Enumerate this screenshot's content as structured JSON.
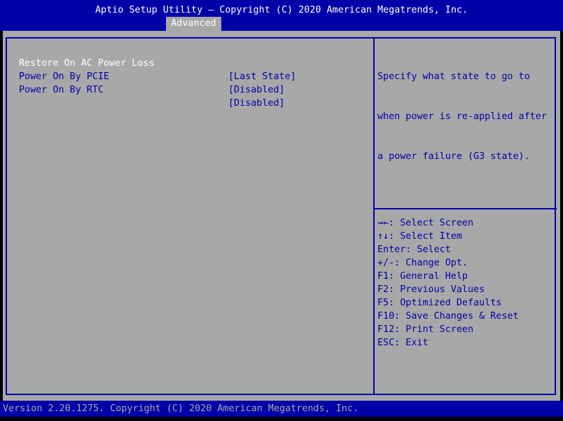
{
  "header": {
    "title": "Aptio Setup Utility – Copyright (C) 2020 American Megatrends, Inc.",
    "tab": "Advanced"
  },
  "settings": [
    {
      "label": "Restore On AC Power Loss",
      "value": "[Last State]"
    },
    {
      "label": "Power On By PCIE",
      "value": "[Disabled]"
    },
    {
      "label": "Power On By RTC",
      "value": "[Disabled]"
    }
  ],
  "help": {
    "lines": [
      "Specify what state to go to",
      "when power is re-applied after",
      "a power failure (G3 state)."
    ]
  },
  "keys": [
    "→←: Select Screen",
    "↑↓: Select Item",
    "Enter: Select",
    "+/-: Change Opt.",
    "F1: General Help",
    "F2: Previous Values",
    "F5: Optimized Defaults",
    "F10: Save Changes & Reset",
    "F12: Print Screen",
    "ESC: Exit"
  ],
  "footer": {
    "text": "Version 2.20.1275. Copyright (C) 2020 American Megatrends, Inc."
  }
}
